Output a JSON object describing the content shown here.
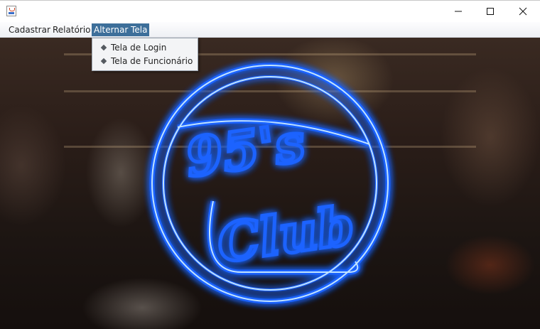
{
  "window": {
    "title": "",
    "icon": "java-cup-icon",
    "controls": {
      "minimize": "minimize-icon",
      "maximize": "maximize-icon",
      "close": "close-icon"
    }
  },
  "menubar": {
    "items": [
      {
        "label": "Cadastrar"
      },
      {
        "label": "Relatório"
      },
      {
        "label": "Alternar Tela",
        "open": true
      }
    ]
  },
  "dropdown": {
    "items": [
      {
        "label": "Tela de Login"
      },
      {
        "label": "Tela de Funcionário"
      }
    ]
  },
  "background": {
    "logo": {
      "line1": "95's",
      "line2": "Club"
    },
    "colors": {
      "neon": "#1e64ff",
      "neon_core": "#9fd4ff",
      "menu_highlight": "#3d6f9a"
    }
  }
}
